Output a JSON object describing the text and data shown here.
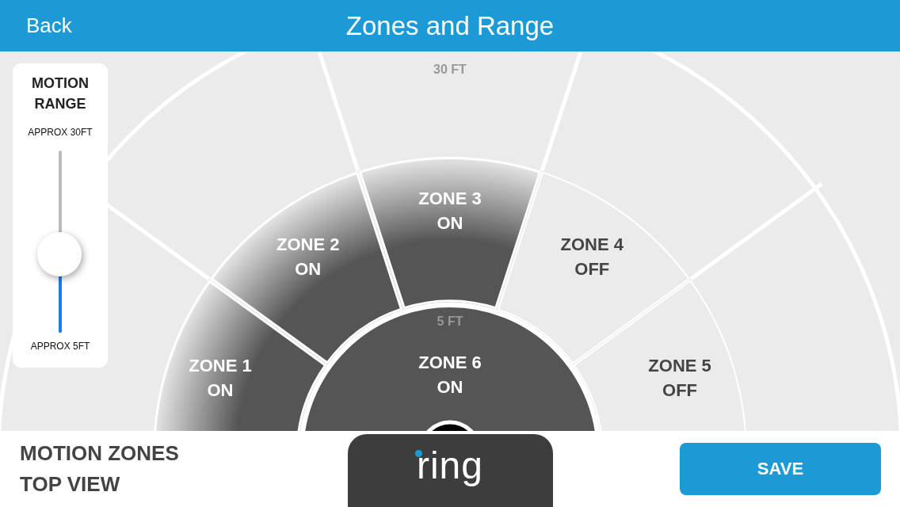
{
  "header": {
    "back": "Back",
    "title": "Zones and Range"
  },
  "range_labels": {
    "outer": "30 FT",
    "inner": "5 FT"
  },
  "motion_range": {
    "title": "MOTION RANGE",
    "max_label": "APPROX 30FT",
    "min_label": "APPROX 5FT",
    "level": 0.43
  },
  "zones": [
    {
      "kind": "sector",
      "name": "ZONE 1",
      "status": "ON",
      "on": true
    },
    {
      "kind": "sector",
      "name": "ZONE 2",
      "status": "ON",
      "on": true
    },
    {
      "kind": "sector",
      "name": "ZONE 3",
      "status": "ON",
      "on": true
    },
    {
      "kind": "sector",
      "name": "ZONE 4",
      "status": "OFF",
      "on": false
    },
    {
      "kind": "center",
      "name": "ZONE 6",
      "status": "ON",
      "on": true
    },
    {
      "kind": "sector",
      "name": "ZONE 5",
      "status": "OFF",
      "on": false
    }
  ],
  "footer": {
    "caption_lines": [
      "MOTION ZONES",
      "TOP VIEW"
    ],
    "logo": "ring",
    "save": "SAVE"
  }
}
